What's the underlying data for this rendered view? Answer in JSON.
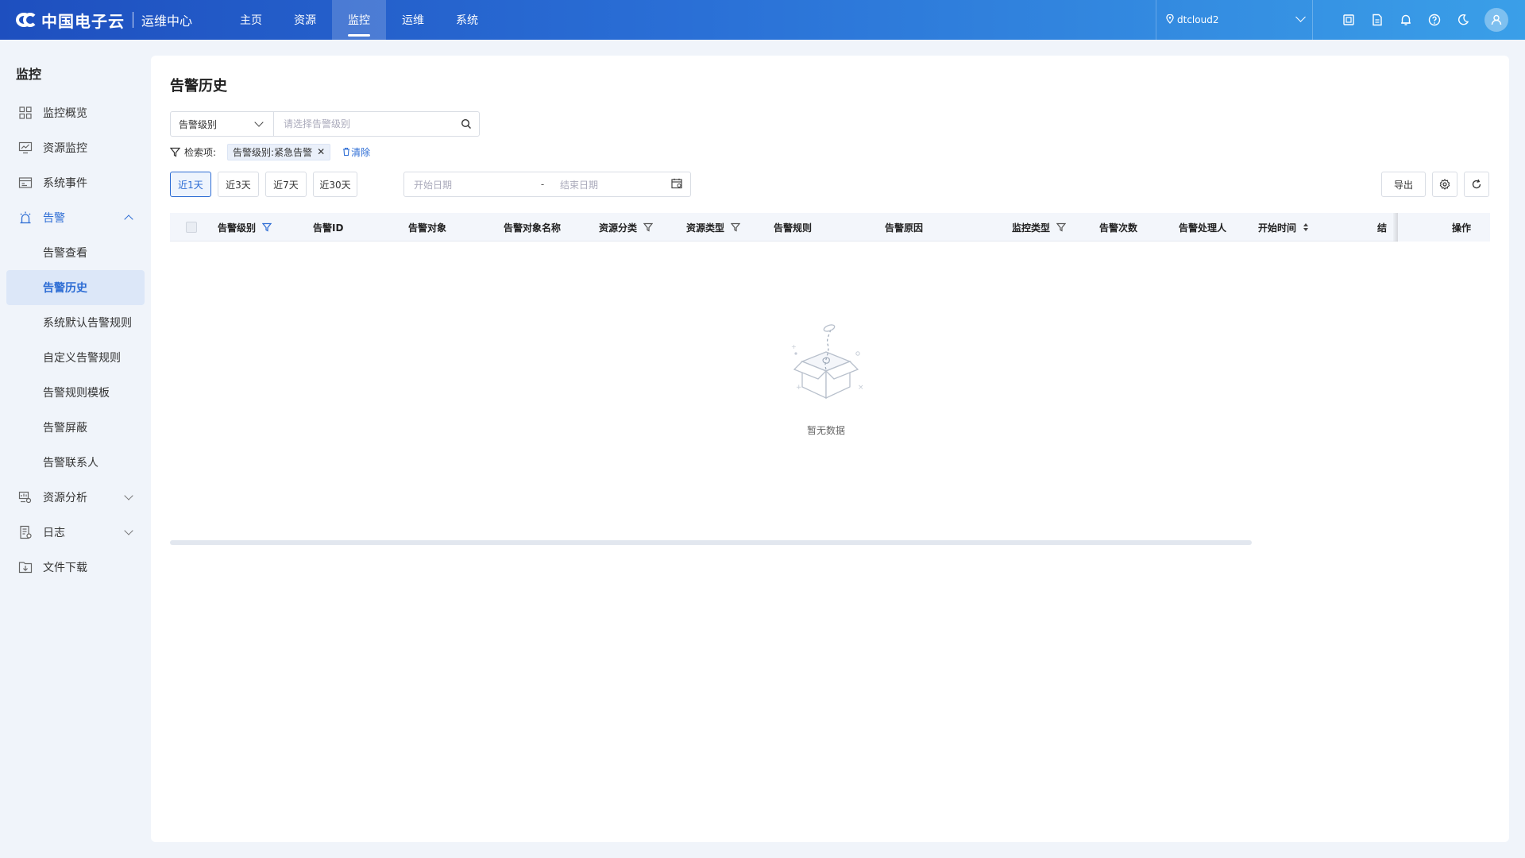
{
  "header": {
    "brand": "中国电子云",
    "subtitle": "运维中心",
    "nav": [
      {
        "label": "主页"
      },
      {
        "label": "资源"
      },
      {
        "label": "监控",
        "active": true
      },
      {
        "label": "运维"
      },
      {
        "label": "系统"
      }
    ],
    "region": "dtcloud2",
    "icons": [
      "screen-icon",
      "document-icon",
      "bell-icon",
      "help-icon",
      "moon-icon",
      "user-icon"
    ]
  },
  "sidebar": {
    "title": "监控",
    "items": [
      {
        "label": "监控概览",
        "icon": "grid-icon"
      },
      {
        "label": "资源监控",
        "icon": "monitor-chart-icon"
      },
      {
        "label": "系统事件",
        "icon": "event-icon"
      },
      {
        "label": "告警",
        "icon": "alarm-icon",
        "expanded": true
      },
      {
        "label": "告警查看",
        "sub": true
      },
      {
        "label": "告警历史",
        "sub": true,
        "active": true
      },
      {
        "label": "系统默认告警规则",
        "sub": true
      },
      {
        "label": "自定义告警规则",
        "sub": true
      },
      {
        "label": "告警规则模板",
        "sub": true
      },
      {
        "label": "告警屏蔽",
        "sub": true
      },
      {
        "label": "告警联系人",
        "sub": true
      },
      {
        "label": "资源分析",
        "icon": "analysis-icon",
        "collapsed": true
      },
      {
        "label": "日志",
        "icon": "log-icon",
        "collapsed": true
      },
      {
        "label": "文件下载",
        "icon": "download-icon"
      }
    ]
  },
  "main": {
    "title": "告警历史",
    "filter": {
      "field": "告警级别",
      "placeholder": "请选择告警级别"
    },
    "criteria": {
      "label": "检索项:",
      "tag": "告警级别:紧急告警",
      "clear": "清除"
    },
    "ranges": [
      "近1天",
      "近3天",
      "近7天",
      "近30天"
    ],
    "active_range": "近1天",
    "date": {
      "start_placeholder": "开始日期",
      "separator": "-",
      "end_placeholder": "结束日期"
    },
    "export": "导出",
    "columns": [
      {
        "label": "告警级别",
        "filter": true
      },
      {
        "label": "告警ID"
      },
      {
        "label": "告警对象"
      },
      {
        "label": "告警对象名称"
      },
      {
        "label": "资源分类",
        "filter": true
      },
      {
        "label": "资源类型",
        "filter": true
      },
      {
        "label": "告警规则"
      },
      {
        "label": "告警原因"
      },
      {
        "label": "监控类型",
        "filter": true
      },
      {
        "label": "告警次数"
      },
      {
        "label": "告警处理人"
      },
      {
        "label": "开始时间",
        "sort": true
      },
      {
        "label": "结"
      },
      {
        "label": "操作"
      }
    ],
    "empty_text": "暂无数据"
  }
}
